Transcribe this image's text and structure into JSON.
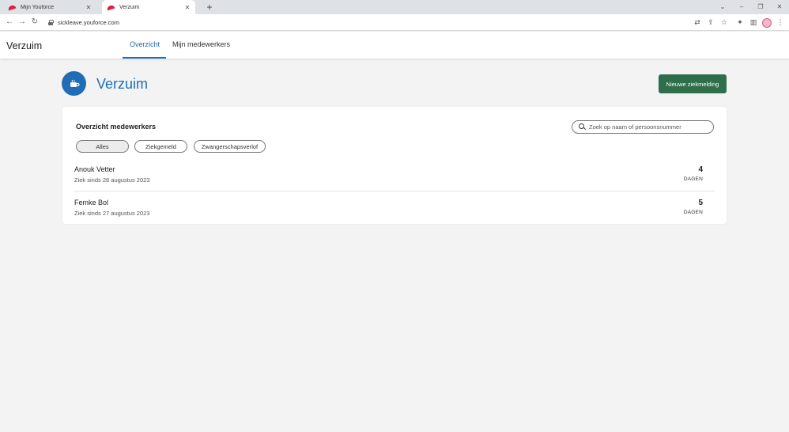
{
  "browser": {
    "tabs": [
      {
        "title": "Mijn Youforce",
        "active": false
      },
      {
        "title": "Verzuim",
        "active": true
      }
    ],
    "url": "sickleave.youforce.com"
  },
  "app": {
    "title": "Verzuim",
    "nav": [
      "Overzicht",
      "Mijn medewerkers"
    ],
    "active_nav": "Overzicht"
  },
  "page": {
    "title": "Verzuim",
    "new_button": "Nieuwe ziekmelding"
  },
  "overview": {
    "title": "Overzicht medewerkers",
    "search_placeholder": "Zoek op naam of persoonsnummer",
    "filters": [
      "Alles",
      "Ziekgemeld",
      "Zwangerschapsverlof"
    ],
    "active_filter": "Alles",
    "employees": [
      {
        "name": "Anouk Vetter",
        "since": "Ziek sinds 28 augustus 2023",
        "days": "4",
        "unit": "DAGEN"
      },
      {
        "name": "Femke Bol",
        "since": "Ziek sinds 27 augustus 2023",
        "days": "5",
        "unit": "DAGEN"
      }
    ]
  },
  "colors": {
    "primary": "#1f6db5",
    "button": "#2e6e4a",
    "background": "#f3f3f3"
  }
}
